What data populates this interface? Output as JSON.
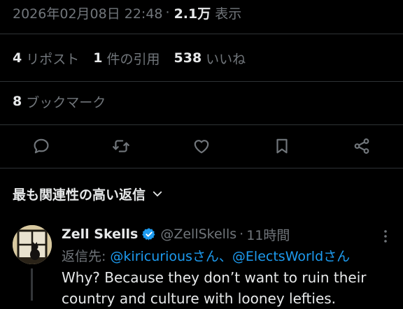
{
  "tweet": {
    "datetime": "2026年02月08日 22:48",
    "separator": "·",
    "views_count": "2.1万",
    "views_label": "表示"
  },
  "stats": {
    "reposts": {
      "num": "4",
      "label": "リポスト"
    },
    "quotes": {
      "num": "1",
      "label": "件の引用"
    },
    "likes": {
      "num": "538",
      "label": "いいね"
    },
    "bookmarks": {
      "num": "8",
      "label": "ブックマーク"
    }
  },
  "actions": [
    "reply-icon",
    "repost-icon",
    "like-icon",
    "bookmark-icon",
    "share-icon"
  ],
  "replies_sort": {
    "label": "最も関連性の高い返信",
    "icon": "chevron-down-icon"
  },
  "reply": {
    "name": "Zell Skells",
    "handle": "@ZellSkells",
    "separator": "·",
    "time": "11時間",
    "reply_to_label": "返信先:",
    "mentions": "@kiricuriousさん、@ElectsWorldさん",
    "text": "Why? Because they don’t want to ruin their country and culture with looney lefties."
  },
  "colors": {
    "background": "#000000",
    "text_primary": "#e7e9ea",
    "text_secondary": "#71767b",
    "divider": "#2f3336",
    "accent": "#1d9bf0"
  }
}
